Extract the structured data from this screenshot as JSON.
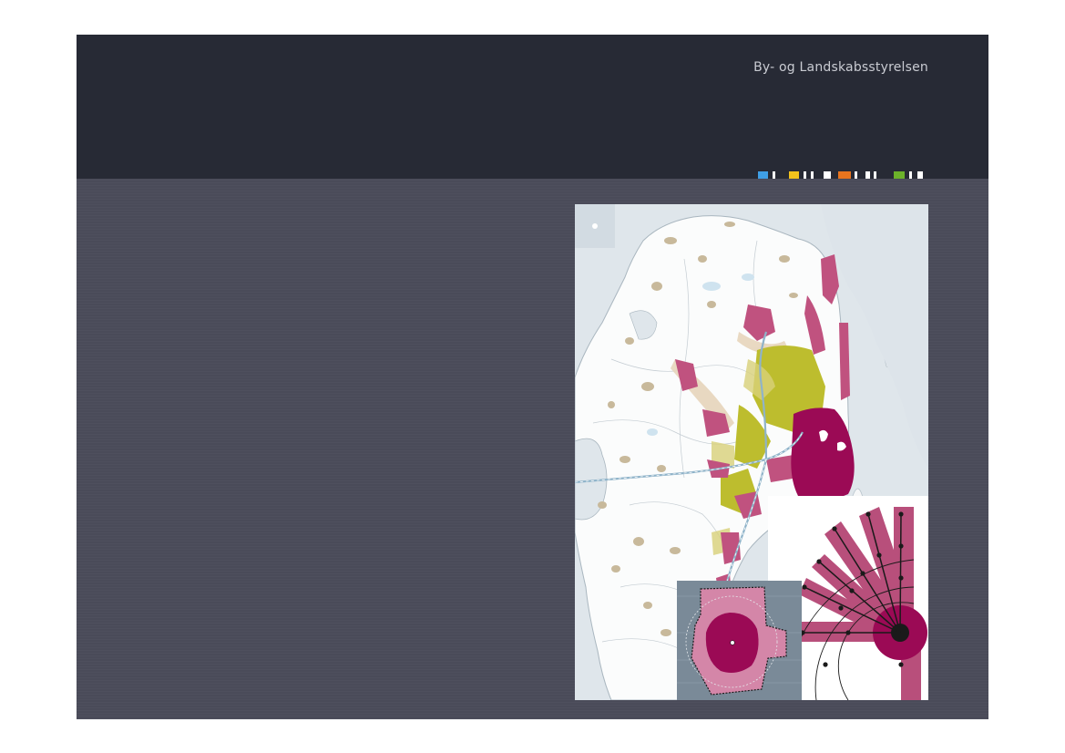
{
  "header": {
    "organization": "By- og Landskabsstyrelsen"
  },
  "colors": {
    "header_bg": "#272a35",
    "page_bg": "#4a4b59",
    "accent_blue": "#3f9fe6",
    "accent_yellow": "#f2c21c",
    "accent_orange": "#e8741e",
    "accent_green": "#6cb22a",
    "map_magenta": "#9b0a55",
    "map_pink": "#c0527f",
    "map_olive": "#b9b92a"
  },
  "figure": {
    "map_icon": "regional-map-illustration",
    "inset_left_icon": "station-catchment-diagram",
    "inset_right_icon": "radial-corridor-diagram"
  }
}
